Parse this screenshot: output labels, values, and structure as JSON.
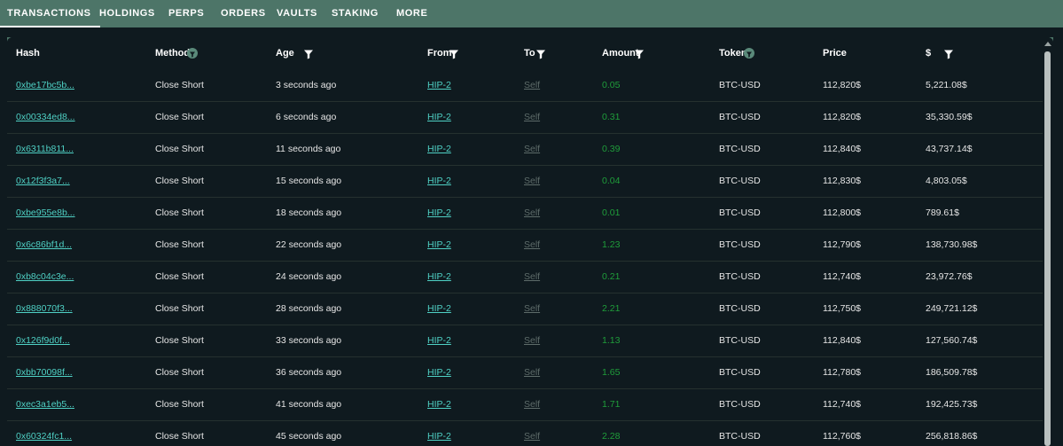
{
  "tabs": [
    {
      "label": "TRANSACTIONS",
      "active": true
    },
    {
      "label": "HOLDINGS",
      "active": false
    },
    {
      "label": "PERPS",
      "active": false
    },
    {
      "label": "ORDERS",
      "active": false
    },
    {
      "label": "VAULTS",
      "active": false
    },
    {
      "label": "STAKING",
      "active": false
    },
    {
      "label": "MORE",
      "active": false
    }
  ],
  "table": {
    "headers": {
      "hash": "Hash",
      "method": "Method",
      "age": "Age",
      "from": "From",
      "to": "To",
      "amount": "Amount",
      "token": "Token",
      "price": "Price",
      "usd": "$"
    },
    "rows": [
      {
        "hash": "0xbe17bc5b...",
        "method": "Close Short",
        "age": "3 seconds ago",
        "from": "HIP-2",
        "to": "Self",
        "amount": "0.05",
        "token": "BTC-USD",
        "price": "112,820$",
        "usd": "5,221.08$"
      },
      {
        "hash": "0x00334ed8...",
        "method": "Close Short",
        "age": "6 seconds ago",
        "from": "HIP-2",
        "to": "Self",
        "amount": "0.31",
        "token": "BTC-USD",
        "price": "112,820$",
        "usd": "35,330.59$"
      },
      {
        "hash": "0x6311b811...",
        "method": "Close Short",
        "age": "11 seconds ago",
        "from": "HIP-2",
        "to": "Self",
        "amount": "0.39",
        "token": "BTC-USD",
        "price": "112,840$",
        "usd": "43,737.14$"
      },
      {
        "hash": "0x12f3f3a7...",
        "method": "Close Short",
        "age": "15 seconds ago",
        "from": "HIP-2",
        "to": "Self",
        "amount": "0.04",
        "token": "BTC-USD",
        "price": "112,830$",
        "usd": "4,803.05$"
      },
      {
        "hash": "0xbe955e8b...",
        "method": "Close Short",
        "age": "18 seconds ago",
        "from": "HIP-2",
        "to": "Self",
        "amount": "0.01",
        "token": "BTC-USD",
        "price": "112,800$",
        "usd": "789.61$"
      },
      {
        "hash": "0x6c86bf1d...",
        "method": "Close Short",
        "age": "22 seconds ago",
        "from": "HIP-2",
        "to": "Self",
        "amount": "1.23",
        "token": "BTC-USD",
        "price": "112,790$",
        "usd": "138,730.98$"
      },
      {
        "hash": "0xb8c04c3e...",
        "method": "Close Short",
        "age": "24 seconds ago",
        "from": "HIP-2",
        "to": "Self",
        "amount": "0.21",
        "token": "BTC-USD",
        "price": "112,740$",
        "usd": "23,972.76$"
      },
      {
        "hash": "0x888070f3...",
        "method": "Close Short",
        "age": "28 seconds ago",
        "from": "HIP-2",
        "to": "Self",
        "amount": "2.21",
        "token": "BTC-USD",
        "price": "112,750$",
        "usd": "249,721.12$"
      },
      {
        "hash": "0x126f9d0f...",
        "method": "Close Short",
        "age": "33 seconds ago",
        "from": "HIP-2",
        "to": "Self",
        "amount": "1.13",
        "token": "BTC-USD",
        "price": "112,840$",
        "usd": "127,560.74$"
      },
      {
        "hash": "0xbb70098f...",
        "method": "Close Short",
        "age": "36 seconds ago",
        "from": "HIP-2",
        "to": "Self",
        "amount": "1.65",
        "token": "BTC-USD",
        "price": "112,780$",
        "usd": "186,509.78$"
      },
      {
        "hash": "0xec3a1eb5...",
        "method": "Close Short",
        "age": "41 seconds ago",
        "from": "HIP-2",
        "to": "Self",
        "amount": "1.71",
        "token": "BTC-USD",
        "price": "112,740$",
        "usd": "192,425.73$"
      },
      {
        "hash": "0x60324fc1...",
        "method": "Close Short",
        "age": "45 seconds ago",
        "from": "HIP-2",
        "to": "Self",
        "amount": "2.28",
        "token": "BTC-USD",
        "price": "112,760$",
        "usd": "256,818.86$"
      }
    ]
  },
  "colors": {
    "tab_bar": "#4d7568",
    "panel": "#0f1a1f",
    "link": "#4fd1c5",
    "amount": "#1f9d3a",
    "muted": "#5d6b69"
  }
}
